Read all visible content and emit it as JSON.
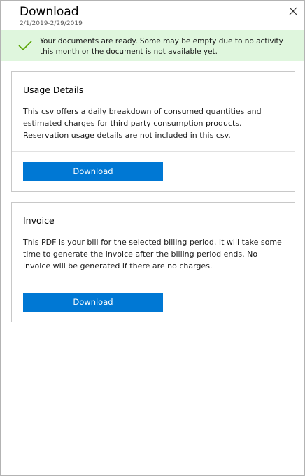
{
  "header": {
    "title": "Download",
    "date_range": "2/1/2019-2/29/2019",
    "close_icon": "close-icon"
  },
  "banner": {
    "icon": "checkmark-icon",
    "message": "Your documents are ready. Some may be empty due to no activity this month or the document is not available yet.",
    "background": "#dff6dd",
    "icon_color": "#57a300"
  },
  "cards": [
    {
      "title": "Usage Details",
      "description": "This csv offers a daily breakdown of consumed quantities and estimated charges for third party consumption products. Reservation usage details are not included in this csv.",
      "button_label": "Download"
    },
    {
      "title": "Invoice",
      "description": "This PDF is your bill for the selected billing period. It will take some time to generate the invoice after the billing period ends. No invoice will be generated if there are no charges.",
      "button_label": "Download"
    }
  ],
  "colors": {
    "accent": "#0078d4",
    "border": "#c8c8c8"
  }
}
